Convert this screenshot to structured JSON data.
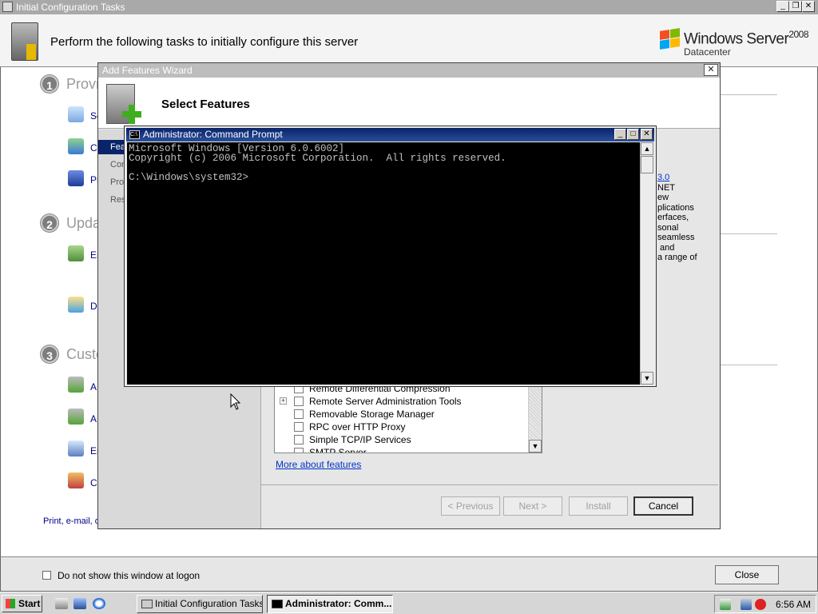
{
  "ict": {
    "title": "Initial Configuration Tasks",
    "header_text": "Perform the following tasks to initially configure this server",
    "logo": {
      "brand": "Windows Server",
      "version": "2008",
      "edition": "Datacenter"
    },
    "sections": [
      {
        "num": "1",
        "title": "Provi"
      },
      {
        "num": "2",
        "title": "Upda"
      },
      {
        "num": "3",
        "title": "Custo"
      }
    ],
    "tasks": [
      "Se",
      "Co",
      "Pr",
      "En",
      "D",
      "A",
      "A",
      "En",
      "Co"
    ],
    "print_link": "Print, e-mail, or",
    "footer": {
      "checkbox_label": "Do not show this window at logon",
      "close_label": "Close"
    }
  },
  "wizard": {
    "title": "Add Features Wizard",
    "heading": "Select Features",
    "nav": [
      "Fea",
      "Con",
      "Pro",
      "Res"
    ],
    "features": [
      {
        "label": "Remote Differential Compression",
        "expandable": false
      },
      {
        "label": "Remote Server Administration Tools",
        "expandable": true
      },
      {
        "label": "Removable Storage Manager",
        "expandable": false
      },
      {
        "label": "RPC over HTTP Proxy",
        "expandable": false
      },
      {
        "label": "Simple TCP/IP Services",
        "expandable": false
      },
      {
        "label": "SMTP Server",
        "expandable": false
      }
    ],
    "more_link": "More about features",
    "description_lines": [
      "3.0",
      "NET",
      "ew",
      "plications",
      "erfaces,",
      "sonal",
      "seamless",
      " and",
      "a range of"
    ],
    "buttons": {
      "previous": "< Previous",
      "next": "Next >",
      "install": "Install",
      "cancel": "Cancel"
    }
  },
  "cmd": {
    "title": "Administrator: Command Prompt",
    "icon_text": "C:\\",
    "lines": [
      "Microsoft Windows [Version 6.0.6002]",
      "Copyright (c) 2006 Microsoft Corporation.  All rights reserved.",
      "",
      "C:\\Windows\\system32>"
    ]
  },
  "taskbar": {
    "start": "Start",
    "tasks": [
      "Initial Configuration Tasks",
      "Administrator: Comm..."
    ],
    "clock": "6:56 AM"
  },
  "colors": {
    "cmd_bg": "#000000",
    "cmd_fg": "#c0c0c0",
    "titlebar_active": "#0a246a",
    "selection": "#0a246a",
    "link": "#0033cc"
  },
  "icons": [
    "server-manager-icon",
    "windows-flag-icon",
    "add-features-icon",
    "cmd-icon",
    "ie-icon",
    "network-icon",
    "security-alert-icon",
    "mouse-cursor-icon"
  ]
}
